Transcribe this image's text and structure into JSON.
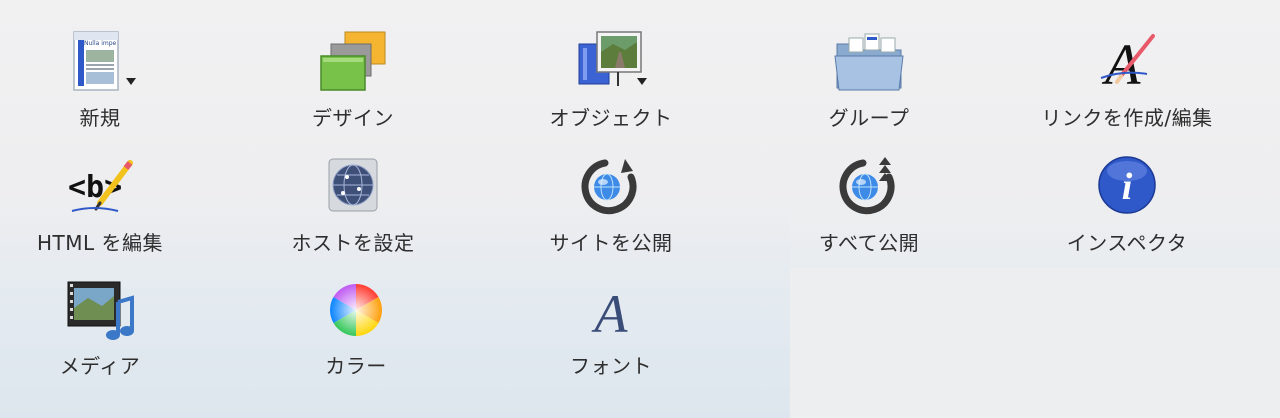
{
  "toolbar": {
    "items": [
      {
        "label": "新規"
      },
      {
        "label": "デザイン"
      },
      {
        "label": "オブジェクト"
      },
      {
        "label": "グループ"
      },
      {
        "label": "リンクを作成/編集"
      },
      {
        "label": "HTML を編集"
      },
      {
        "label": "ホストを設定"
      },
      {
        "label": "サイトを公開"
      },
      {
        "label": "すべて公開"
      },
      {
        "label": "インスペクタ"
      },
      {
        "label": "メディア"
      },
      {
        "label": "カラー"
      },
      {
        "label": "フォント"
      }
    ],
    "new_icon_text": "Nulla impe",
    "link_icon_letter": "A",
    "font_icon_letter": "A",
    "html_icon_text": "<b>",
    "inspector_icon_letter": "i"
  },
  "colors": {
    "text": "#2e2e2e",
    "accent_blue": "#2f58c9",
    "design_orange": "#f6b531",
    "design_green": "#79c24a"
  }
}
